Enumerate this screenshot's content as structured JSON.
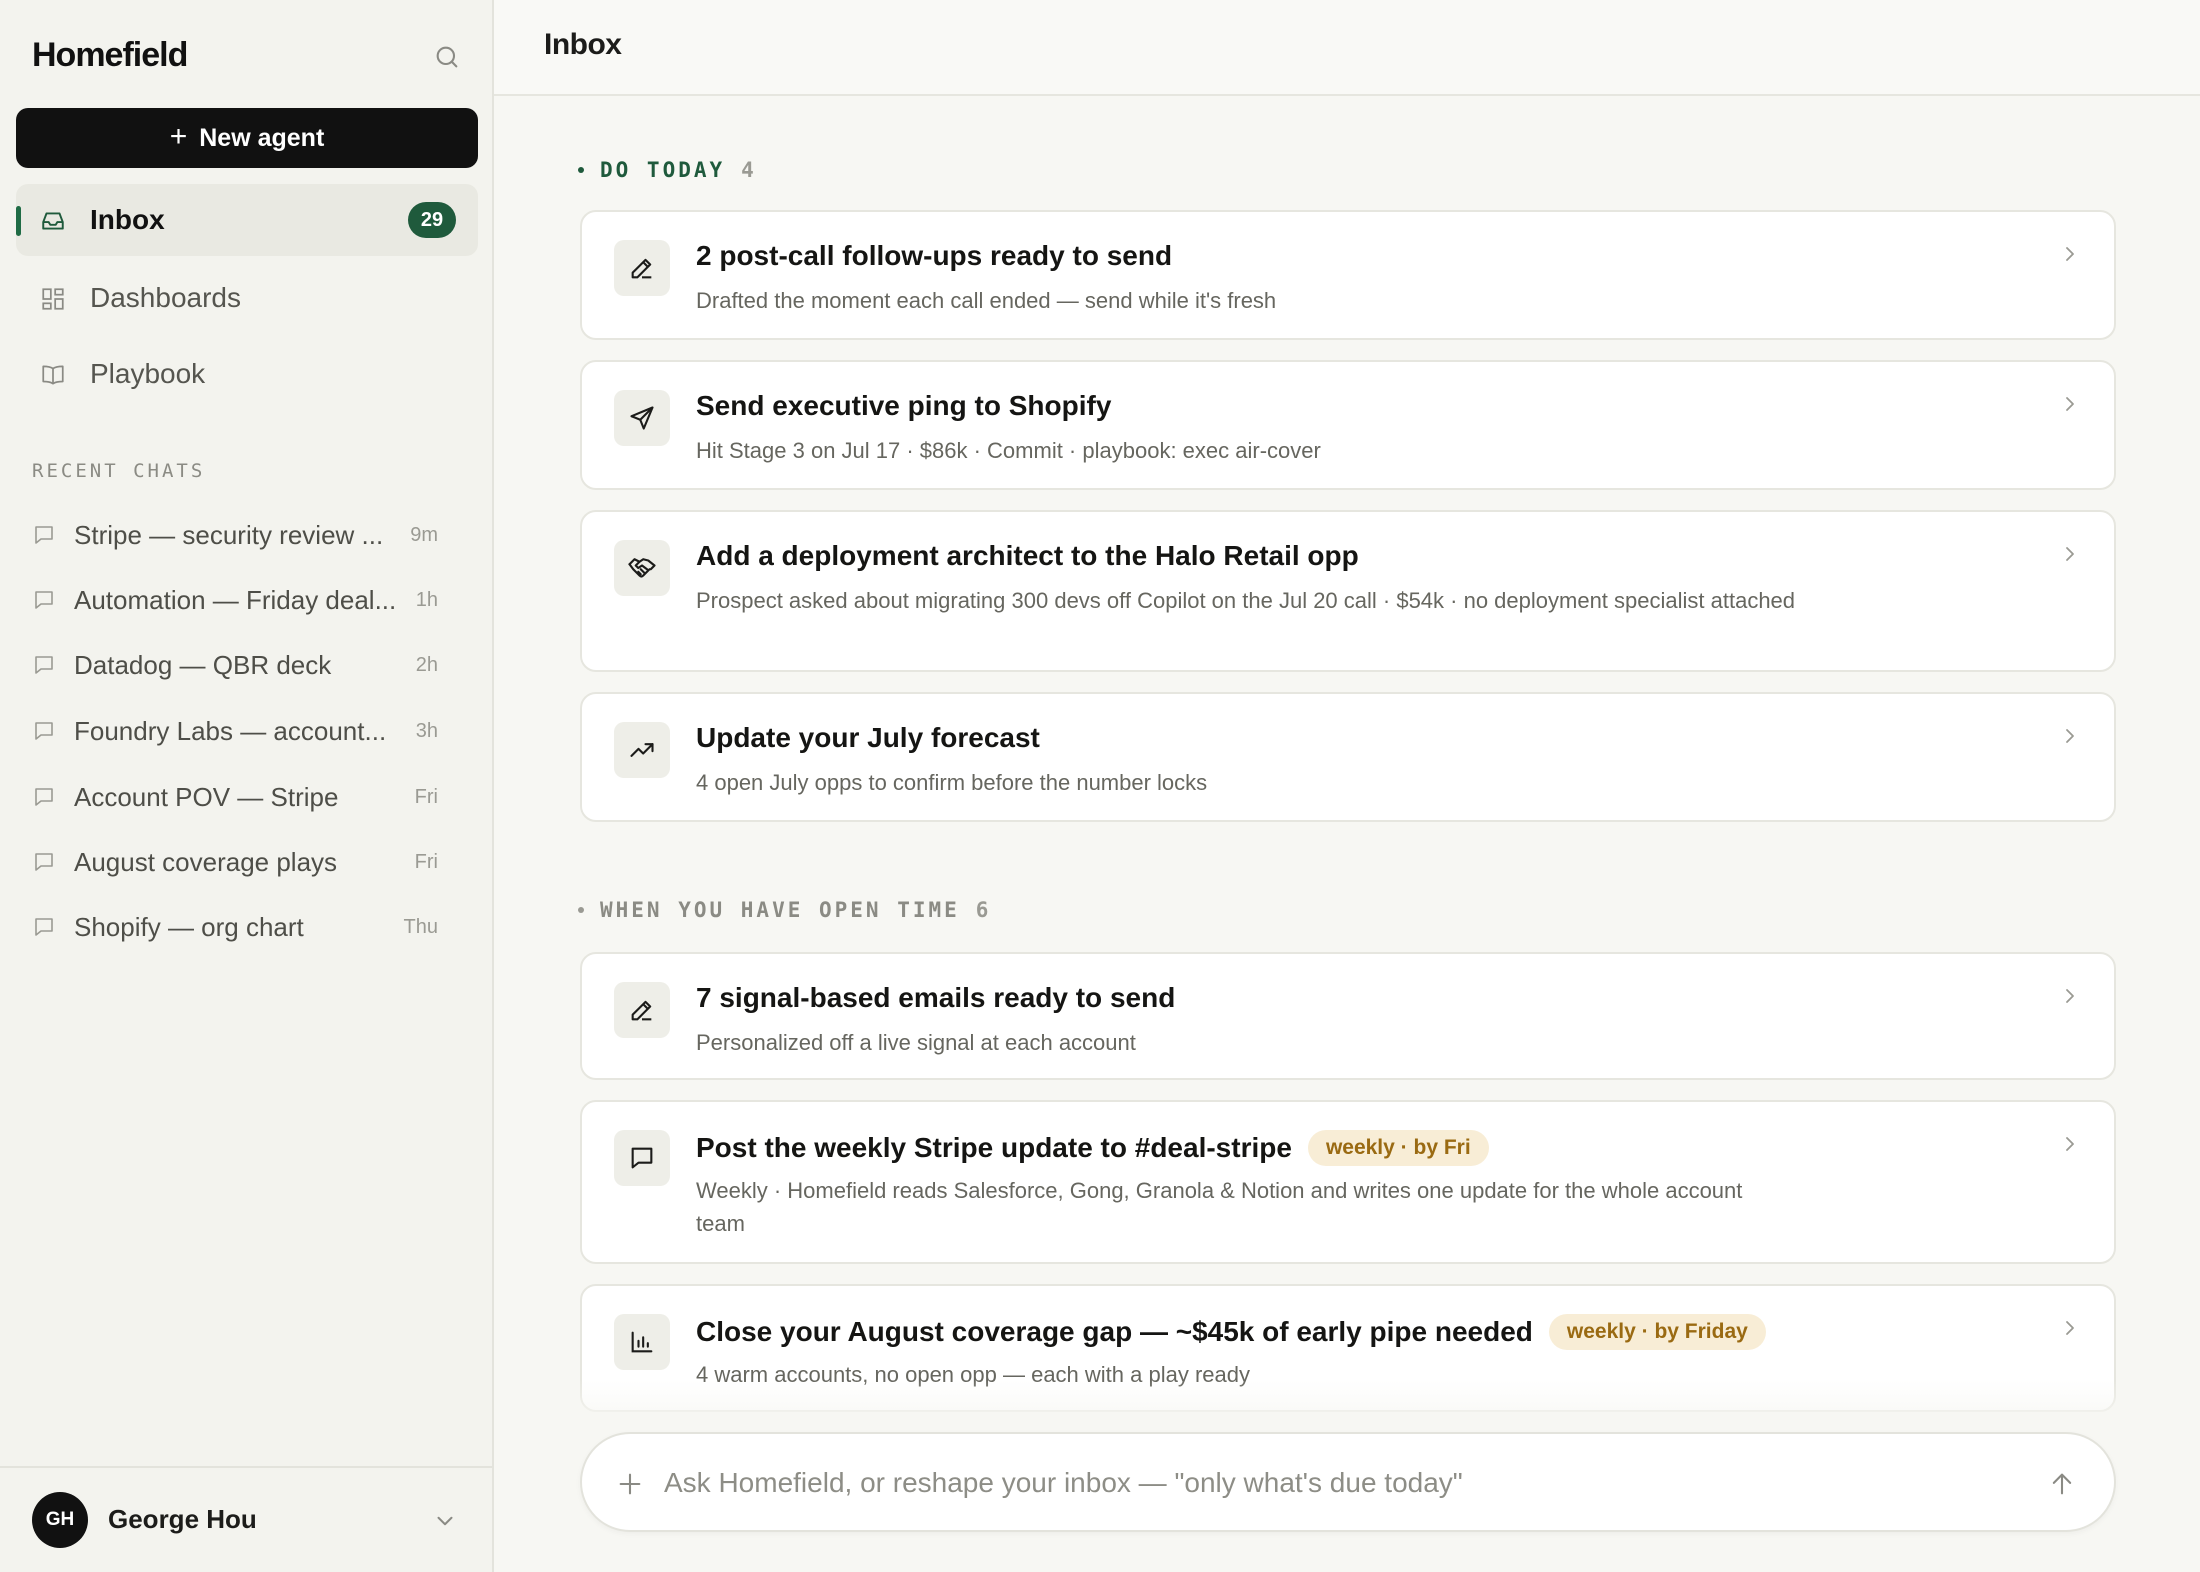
{
  "app": {
    "brand": "Homefield"
  },
  "sidebar": {
    "new_agent_label": "New agent",
    "nav": [
      {
        "label": "Inbox",
        "badge": "29",
        "icon": "inbox-icon"
      },
      {
        "label": "Dashboards",
        "icon": "dashboard-icon"
      },
      {
        "label": "Playbook",
        "icon": "book-icon"
      }
    ],
    "recent_label": "RECENT CHATS",
    "recent_chats": [
      {
        "label": "Stripe — security review ...",
        "time": "9m"
      },
      {
        "label": "Automation — Friday deal...",
        "time": "1h"
      },
      {
        "label": "Datadog — QBR deck",
        "time": "2h"
      },
      {
        "label": "Foundry Labs — account...",
        "time": "3h"
      },
      {
        "label": "Account POV — Stripe",
        "time": "Fri"
      },
      {
        "label": "August coverage plays",
        "time": "Fri"
      },
      {
        "label": "Shopify — org chart",
        "time": "Thu"
      }
    ],
    "user": {
      "initials": "GH",
      "name": "George Hou"
    }
  },
  "header": {
    "title": "Inbox"
  },
  "groups": [
    {
      "label": "DO TODAY",
      "count": "4",
      "cards": [
        {
          "icon": "pencil-icon",
          "title": "2 post-call follow-ups ready to send",
          "desc": "Drafted the moment each call ended — send while it's fresh"
        },
        {
          "icon": "send-icon",
          "title": "Send executive ping to Shopify",
          "desc": "Hit Stage 3 on Jul 17 · $86k · Commit · playbook: exec air-cover"
        },
        {
          "icon": "handshake-icon",
          "title": "Add a deployment architect to the Halo Retail opp",
          "desc": "Prospect asked about migrating 300 devs off Copilot on the Jul 20 call · $54k · no deployment specialist attached"
        },
        {
          "icon": "trend-up-icon",
          "title": "Update your July forecast",
          "desc": "4 open July opps to confirm before the number locks"
        }
      ]
    },
    {
      "label": "WHEN YOU HAVE OPEN TIME",
      "count": "6",
      "cards": [
        {
          "icon": "pencil-icon",
          "title": "7 signal-based emails ready to send",
          "desc": "Personalized off a live signal at each account"
        },
        {
          "icon": "message-icon",
          "title": "Post the weekly Stripe update to #deal-stripe",
          "tag": "weekly · by Fri",
          "desc": "Weekly · Homefield reads Salesforce, Gong, Granola & Notion and writes one update for the whole account team"
        },
        {
          "icon": "bar-chart-icon",
          "title": "Close your August coverage gap — ~$45k of early pipe needed",
          "tag": "weekly · by Friday",
          "desc": "4 warm accounts, no open opp — each with a play ready"
        }
      ]
    }
  ],
  "composer": {
    "placeholder": "Ask Homefield, or reshape your inbox — \"only what's due today\""
  },
  "colors": {
    "accent": "#1f5a3c",
    "tag_bg": "#f8edd6",
    "tag_text": "#9a6a12",
    "primary_button": "#111111"
  }
}
